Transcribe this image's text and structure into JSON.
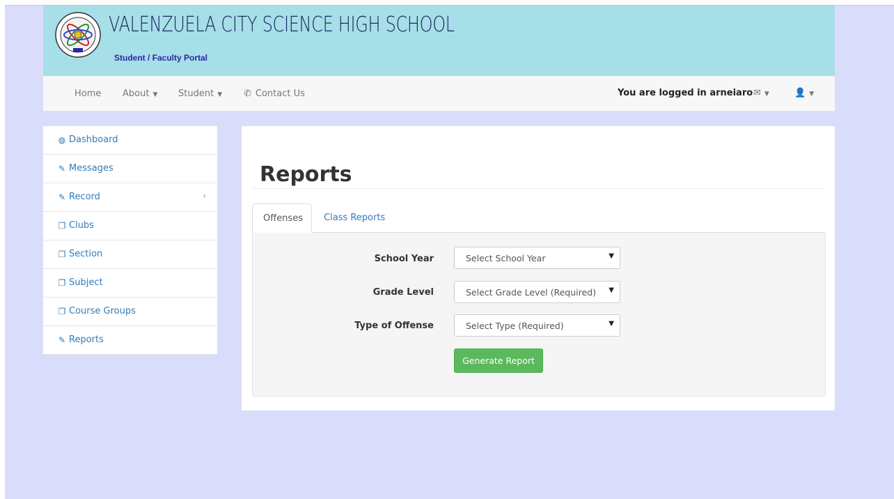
{
  "header": {
    "school_name": "VALENZUELA CITY SCIENCE HIGH SCHOOL",
    "portal_name": "Student / Faculty Portal",
    "logo_icon": "school-seal-icon",
    "background_color": "#a6dfe7"
  },
  "navbar": {
    "items": [
      {
        "label": "Home"
      },
      {
        "label": "About"
      },
      {
        "label": "Student"
      },
      {
        "label": "Contact Us",
        "icon": "phone-icon"
      }
    ],
    "logged_in_text": "You are logged in arneiaro",
    "envelope_icon": "envelope-icon",
    "user_icon": "user-icon"
  },
  "sidebar": {
    "items": [
      {
        "label": "Dashboard",
        "icon": "dashboard-icon"
      },
      {
        "label": "Messages",
        "icon": "edit-icon"
      },
      {
        "label": "Record",
        "icon": "edit-icon"
      },
      {
        "label": "Clubs",
        "icon": "copy-icon"
      },
      {
        "label": "Section",
        "icon": "copy-icon"
      },
      {
        "label": "Subject",
        "icon": "copy-icon"
      },
      {
        "label": "Course Groups",
        "icon": "copy-icon"
      },
      {
        "label": "Reports",
        "icon": "edit-icon"
      }
    ]
  },
  "main": {
    "title": "Reports",
    "tabs": [
      {
        "label": "Offenses",
        "active": true
      },
      {
        "label": "Class Reports",
        "active": false
      }
    ],
    "form": {
      "school_year": {
        "label": "School Year",
        "value": "Select School Year"
      },
      "grade_level": {
        "label": "Grade Level",
        "value": "Select Grade Level (Required)"
      },
      "offense_type": {
        "label": "Type of Offense",
        "value": "Select Type (Required)"
      },
      "submit_label": "Generate Report"
    }
  },
  "colors": {
    "page_background": "#dadcfb",
    "link": "#337ab7",
    "button_success": "#5cb85c"
  }
}
